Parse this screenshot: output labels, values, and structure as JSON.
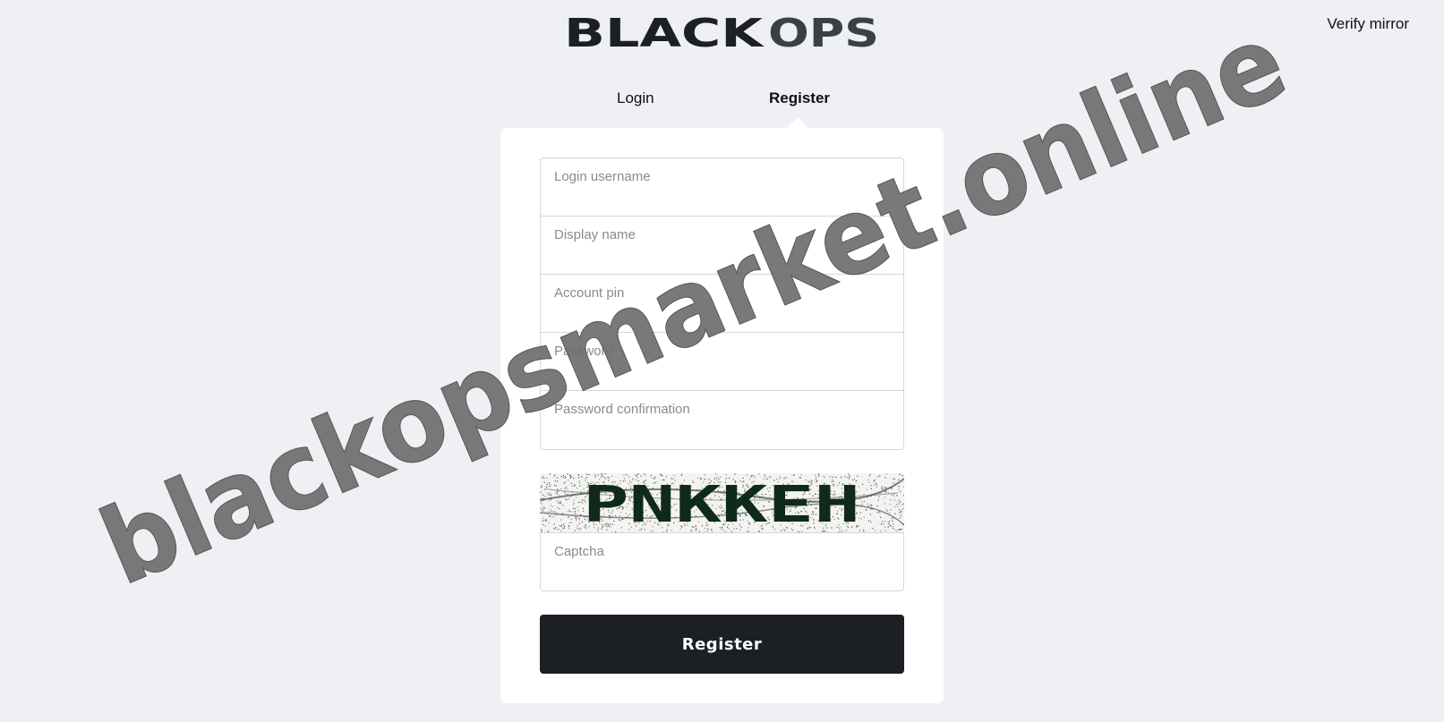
{
  "header": {
    "logo_text": "BLACK OPS",
    "verify_mirror_label": "Verify mirror"
  },
  "tabs": [
    {
      "label": "Login",
      "active": false
    },
    {
      "label": "Register",
      "active": true
    }
  ],
  "form": {
    "fields": [
      {
        "label": "Login username",
        "value": ""
      },
      {
        "label": "Display name",
        "value": ""
      },
      {
        "label": "Account pin",
        "value": ""
      },
      {
        "label": "Password",
        "value": ""
      },
      {
        "label": "Password confirmation",
        "value": ""
      }
    ],
    "captcha": {
      "image_text": "PNKKEH",
      "label": "Captcha",
      "value": ""
    },
    "submit_label": "Register"
  },
  "watermark": {
    "text": "blackopsmarket.online"
  },
  "colors": {
    "background": "#eff0f4",
    "card": "#ffffff",
    "button": "#1c1f23",
    "logo_dark": "#1c1f23",
    "logo_ops": "#3a4048",
    "captcha_ink": "#0f2a1a",
    "watermark": "#6e6e6e"
  }
}
